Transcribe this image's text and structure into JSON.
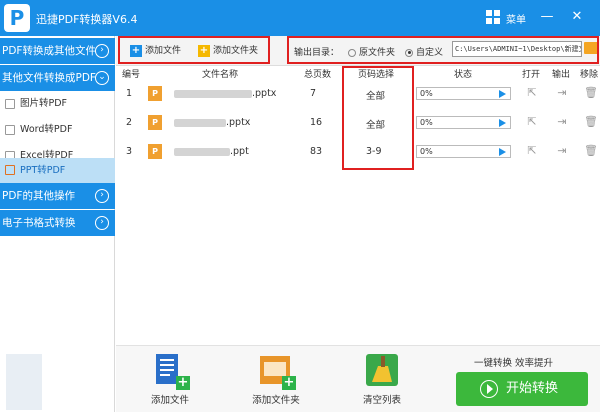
{
  "app": {
    "title": "迅捷PDF转换器V6.4",
    "logo_letter": "P",
    "menu_label": "菜单"
  },
  "icons": {
    "menu": "grid-icon",
    "minimize": "minimize-icon",
    "close": "close-icon"
  },
  "colors": {
    "accent": "#1a8fe6",
    "start": "#3cb83c",
    "highlight": "#e02020",
    "file_icon": "#f0a030"
  },
  "sidebar": {
    "categories": [
      {
        "label": "PDF转换成其他文件"
      },
      {
        "label": "其他文件转换成PDF"
      },
      {
        "label": "PDF的其他操作"
      },
      {
        "label": "电子书格式转换"
      }
    ],
    "items": [
      {
        "label": "图片转PDF"
      },
      {
        "label": "Word转PDF"
      },
      {
        "label": "Excel转PDF"
      },
      {
        "label": "PPT转PDF"
      }
    ]
  },
  "toolbar": {
    "add_file": "添加文件",
    "add_folder": "添加文件夹",
    "output_label": "输出目录：",
    "opt_original": "原文件夹",
    "opt_custom": "自定义",
    "path": "C:\\Users\\ADMINI~1\\Desktop\\新建文"
  },
  "table": {
    "headers": {
      "num": "编号",
      "name": "文件名称",
      "pages": "总页数",
      "range": "页码选择",
      "status": "状态",
      "open": "打开",
      "output": "输出",
      "remove": "移除"
    },
    "rows": [
      {
        "num": "1",
        "ext": ".pptx",
        "pages": "7",
        "range": "全部",
        "progress": "0%"
      },
      {
        "num": "2",
        "ext": ".pptx",
        "pages": "16",
        "range": "全部",
        "progress": "0%"
      },
      {
        "num": "3",
        "ext": ".ppt",
        "pages": "83",
        "range": "3-9",
        "progress": "0%"
      }
    ]
  },
  "bottom": {
    "add_file": "添加文件",
    "add_folder": "添加文件夹",
    "clear": "清空列表",
    "tip": "一键转换  效率提升",
    "start": "开始转换"
  }
}
